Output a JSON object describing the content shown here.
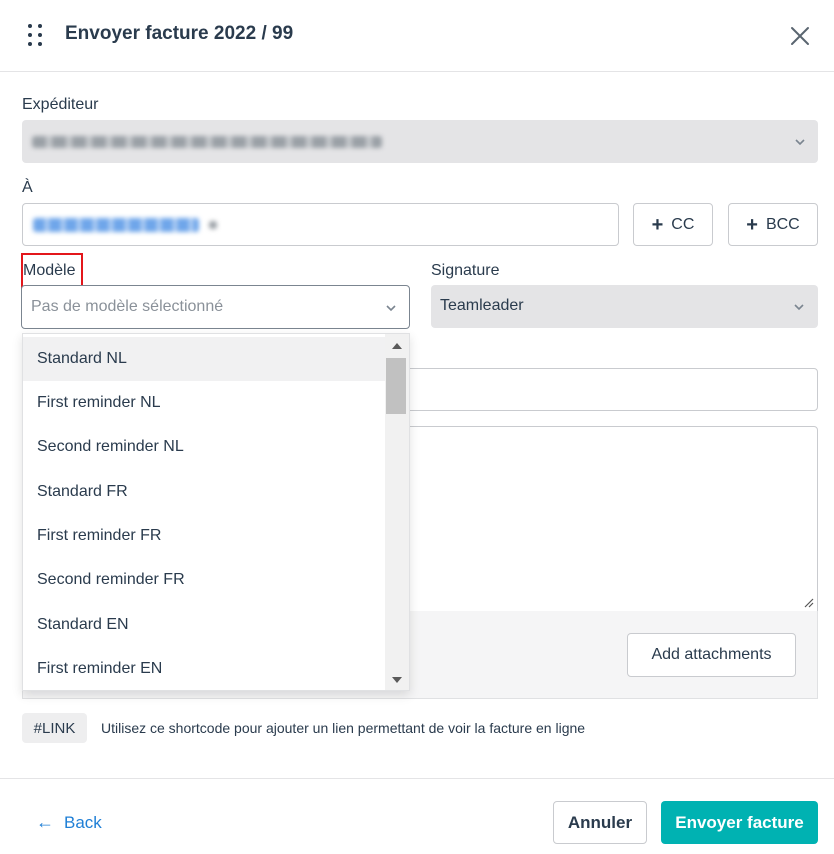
{
  "header": {
    "title": "Envoyer facture 2022 / 99"
  },
  "sender": {
    "label": "Expéditeur"
  },
  "to": {
    "label": "À"
  },
  "cc_button": {
    "label": "CC"
  },
  "bcc_button": {
    "label": "BCC"
  },
  "template": {
    "label": "Modèle",
    "placeholder": "Pas de modèle sélectionné",
    "options": [
      "Standard NL",
      "First reminder NL",
      "Second reminder NL",
      "Standard FR",
      "First reminder FR",
      "Second reminder FR",
      "Standard EN",
      "First reminder EN"
    ]
  },
  "signature": {
    "label": "Signature",
    "value": "Teamleader"
  },
  "attachments": {
    "button_label": "Add attachments"
  },
  "shortcode": {
    "tag": "#LINK",
    "hint": "Utilisez ce shortcode pour ajouter un lien permettant de voir la facture en ligne"
  },
  "footer": {
    "back_label": "Back",
    "cancel_label": "Annuler",
    "send_label": "Envoyer facture"
  },
  "icons": {
    "drag": "drag-handle-icon",
    "close": "close-icon",
    "chevron": "chevron-down-icon",
    "plus": "plus-icon",
    "back": "arrow-left-icon",
    "resize": "resize-handle-icon"
  },
  "colors": {
    "primary": "#00b2b2",
    "link": "#1f7fd6",
    "highlight": "#e3161b",
    "text": "#2a3b4d"
  }
}
